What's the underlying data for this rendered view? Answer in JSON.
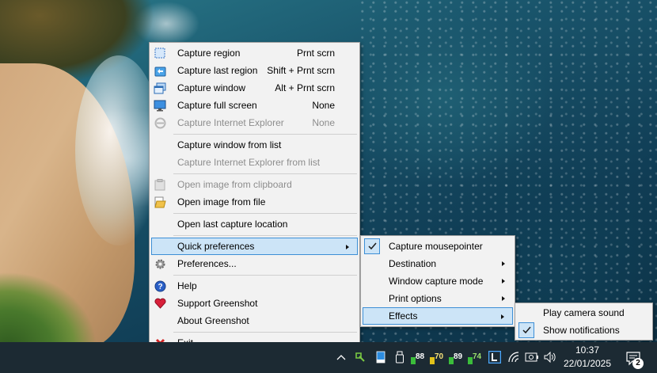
{
  "main_menu": {
    "items": [
      {
        "label": "Capture region",
        "shortcut": "Prnt scrn",
        "icon": "region-icon"
      },
      {
        "label": "Capture last region",
        "shortcut": "Shift + Prnt scrn",
        "icon": "last-region-icon"
      },
      {
        "label": "Capture window",
        "shortcut": "Alt + Prnt scrn",
        "icon": "window-icon"
      },
      {
        "label": "Capture full screen",
        "shortcut": "None",
        "icon": "monitor-icon"
      },
      {
        "label": "Capture Internet Explorer",
        "shortcut": "None",
        "icon": "ie-icon"
      },
      {
        "label": "Capture window from list"
      },
      {
        "label": "Capture Internet Explorer from list"
      },
      {
        "label": "Open image from clipboard",
        "icon": "clipboard-icon"
      },
      {
        "label": "Open image from file",
        "icon": "folder-file-icon"
      },
      {
        "label": "Open last capture location"
      },
      {
        "label": "Quick preferences"
      },
      {
        "label": "Preferences...",
        "icon": "gear-icon"
      },
      {
        "label": "Help",
        "icon": "help-icon"
      },
      {
        "label": "Support Greenshot",
        "icon": "heart-icon"
      },
      {
        "label": "About Greenshot"
      },
      {
        "label": "Exit",
        "icon": "close-icon"
      }
    ]
  },
  "quick_prefs_menu": {
    "items": [
      {
        "label": "Capture mousepointer",
        "checked": true
      },
      {
        "label": "Destination"
      },
      {
        "label": "Window capture mode"
      },
      {
        "label": "Print options"
      },
      {
        "label": "Effects"
      }
    ]
  },
  "effects_menu": {
    "items": [
      {
        "label": "Play camera sound",
        "checked": false
      },
      {
        "label": "Show notifications",
        "checked": true
      }
    ]
  },
  "taskbar": {
    "tray_labels": [
      "88",
      "70",
      "89",
      "74"
    ],
    "time": "10:37",
    "date": "22/01/2025",
    "notification_count": "2"
  },
  "colors": {
    "highlight": "#cce4f7",
    "highlight_border": "#3d8fd6",
    "taskbar": "#1c2a33"
  }
}
